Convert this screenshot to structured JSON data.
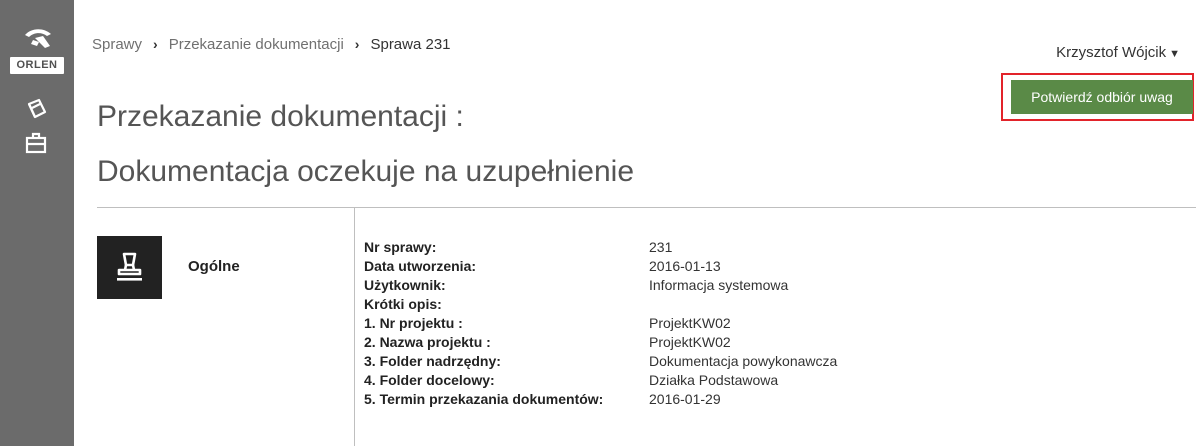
{
  "sidebar": {
    "logo_text": "ORLEN",
    "icons": [
      "documents-icon",
      "briefcase-icon"
    ]
  },
  "breadcrumb": {
    "items": [
      "Sprawy",
      "Przekazanie dokumentacji",
      "Sprawa 231"
    ]
  },
  "user": {
    "name": "Krzysztof Wójcik"
  },
  "actions": {
    "confirm_label": "Potwierdź odbiór uwag",
    "confirm_color": "#5a8a47",
    "highlight_color": "#e2232a"
  },
  "page": {
    "title": "Przekazanie dokumentacji :",
    "subtitle": "Dokumentacja oczekuje na uzupełnienie"
  },
  "section": {
    "icon": "stamp-icon",
    "label": "Ogólne"
  },
  "details": [
    {
      "label": "Nr sprawy:",
      "value": "231"
    },
    {
      "label": "Data utworzenia:",
      "value": "2016-01-13"
    },
    {
      "label": "Użytkownik:",
      "value": "Informacja systemowa"
    },
    {
      "label": "Krótki opis:",
      "value": ""
    },
    {
      "label": "1. Nr projektu :",
      "value": "ProjektKW02"
    },
    {
      "label": "2. Nazwa projektu :",
      "value": "ProjektKW02"
    },
    {
      "label": "3. Folder nadrzędny:",
      "value": "Dokumentacja powykonawcza"
    },
    {
      "label": "4. Folder docelowy:",
      "value": "Działka Podstawowa"
    },
    {
      "label": "5. Termin przekazania dokumentów:",
      "value": "2016-01-29"
    }
  ]
}
